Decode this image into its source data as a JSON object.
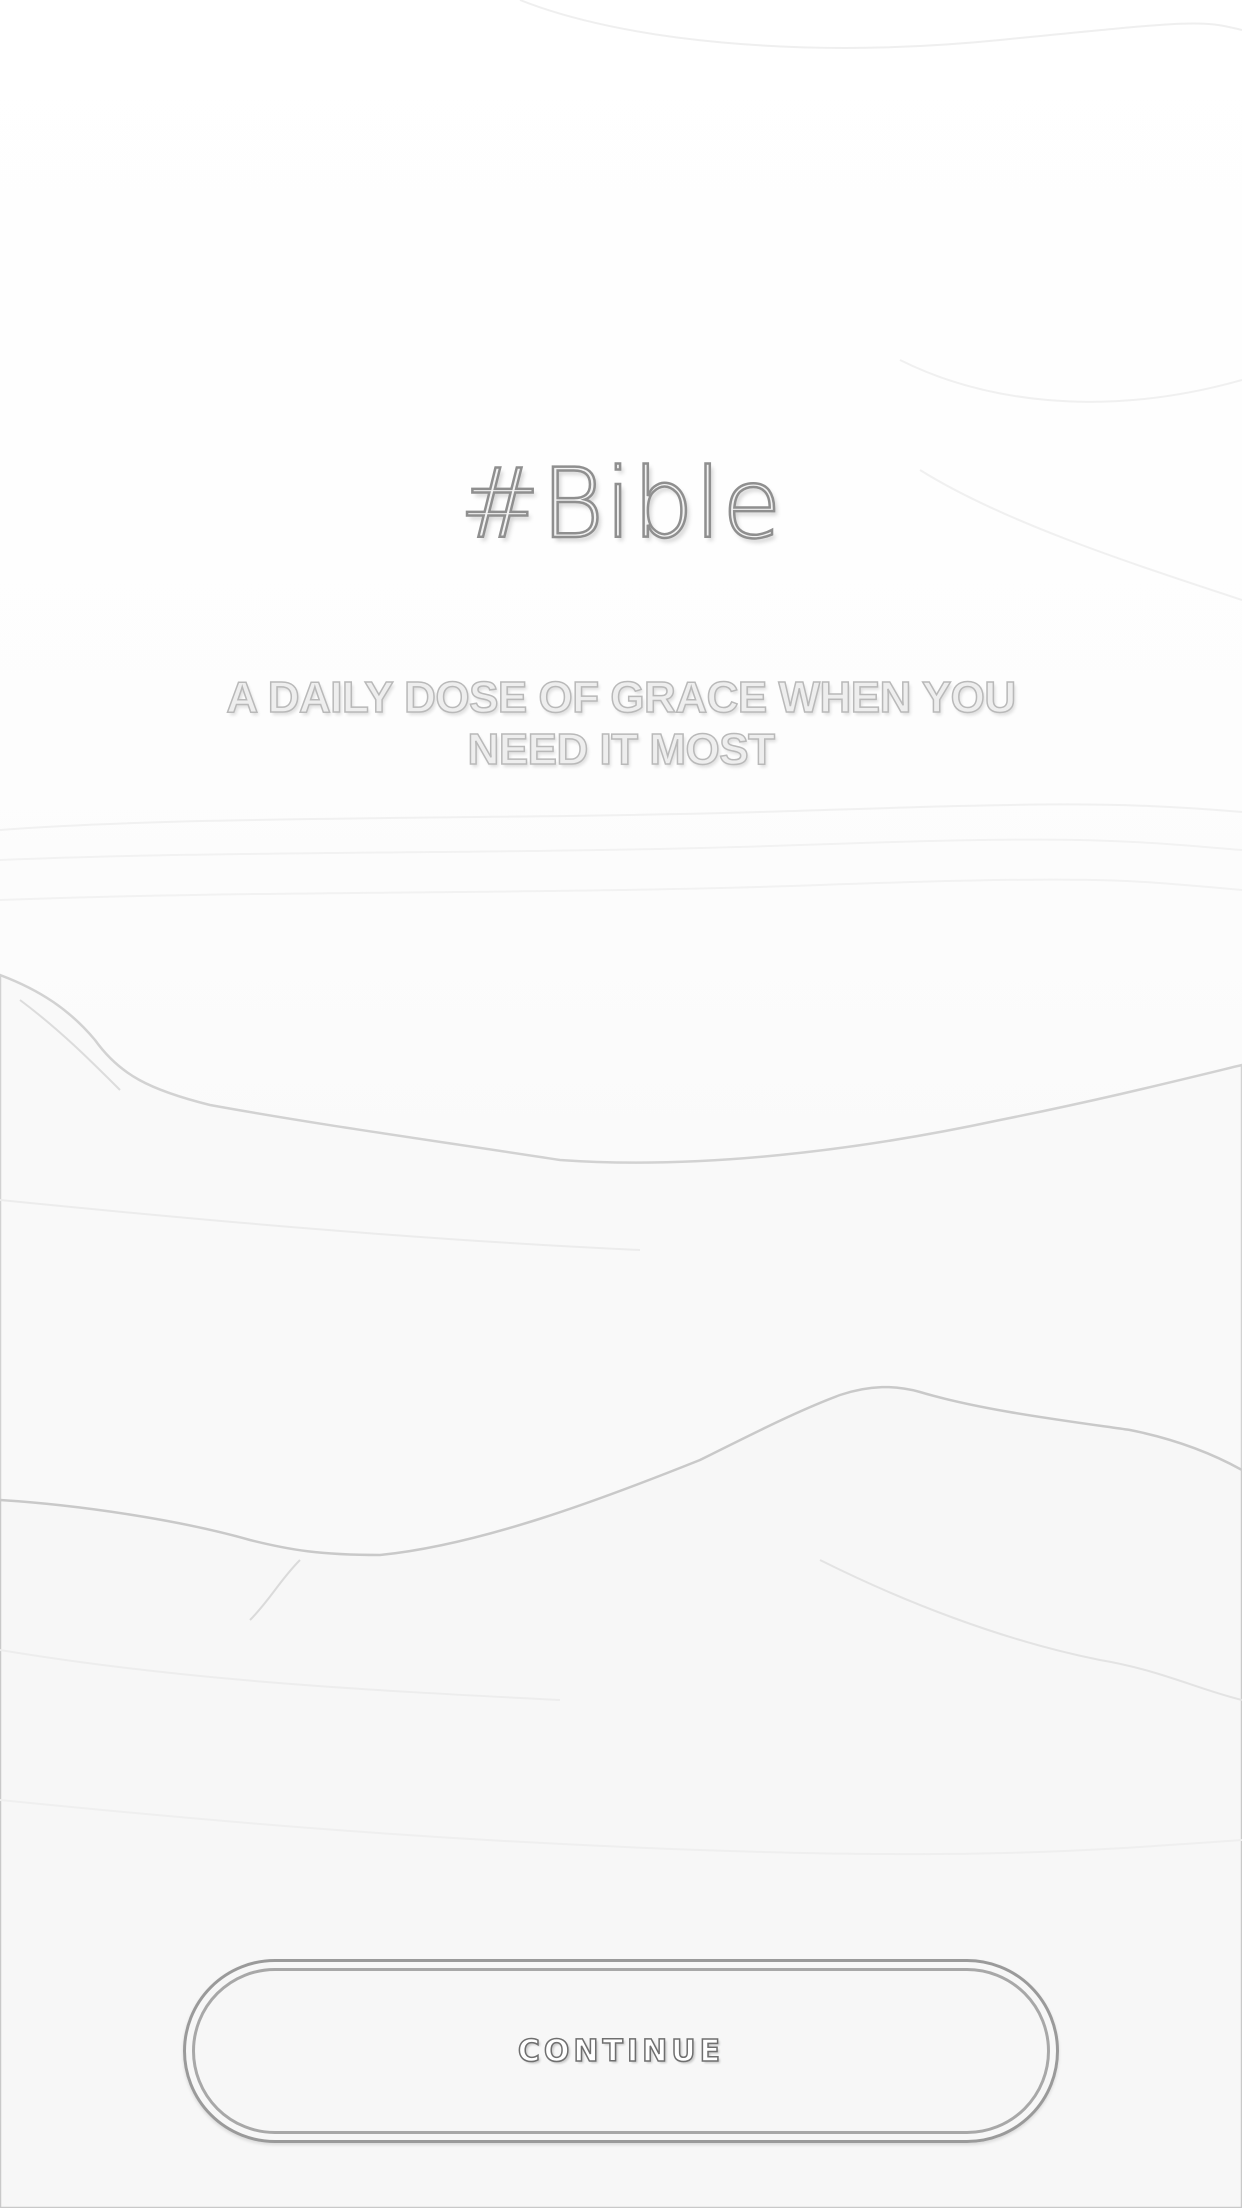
{
  "app": {
    "title": "#Bible",
    "tagline": "A DAILY DOSE OF GRACE WHEN YOU NEED IT MOST"
  },
  "actions": {
    "continue_label": "CONTINUE"
  },
  "colors": {
    "background": "#fbfbfb",
    "text_outline": "#8f8f8f",
    "button_outline": "#9a9a9a"
  }
}
